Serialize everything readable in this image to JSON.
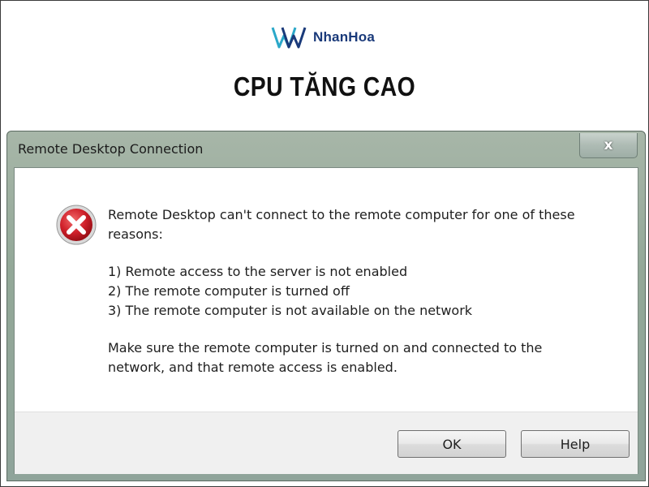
{
  "brand": {
    "name": "NhanHoa",
    "logo_icon": "nhanhoa-logo-icon",
    "color": "#1a3a7a"
  },
  "headline": "CPU TĂNG CAO",
  "dialog": {
    "title": "Remote Desktop Connection",
    "close_label": "x",
    "icon": "error-icon",
    "message_lines": [
      "Remote Desktop can't connect to the remote computer for one of these",
      "reasons:"
    ],
    "reasons": [
      "1) Remote access to the server is not enabled",
      "2) The remote computer is turned off",
      "3) The remote computer is not available on the network"
    ],
    "advice_lines": [
      "Make sure the remote computer is turned on and connected to the",
      "network, and that remote access is enabled."
    ],
    "buttons": {
      "ok": "OK",
      "help": "Help"
    },
    "error_color": "#c8161e"
  }
}
